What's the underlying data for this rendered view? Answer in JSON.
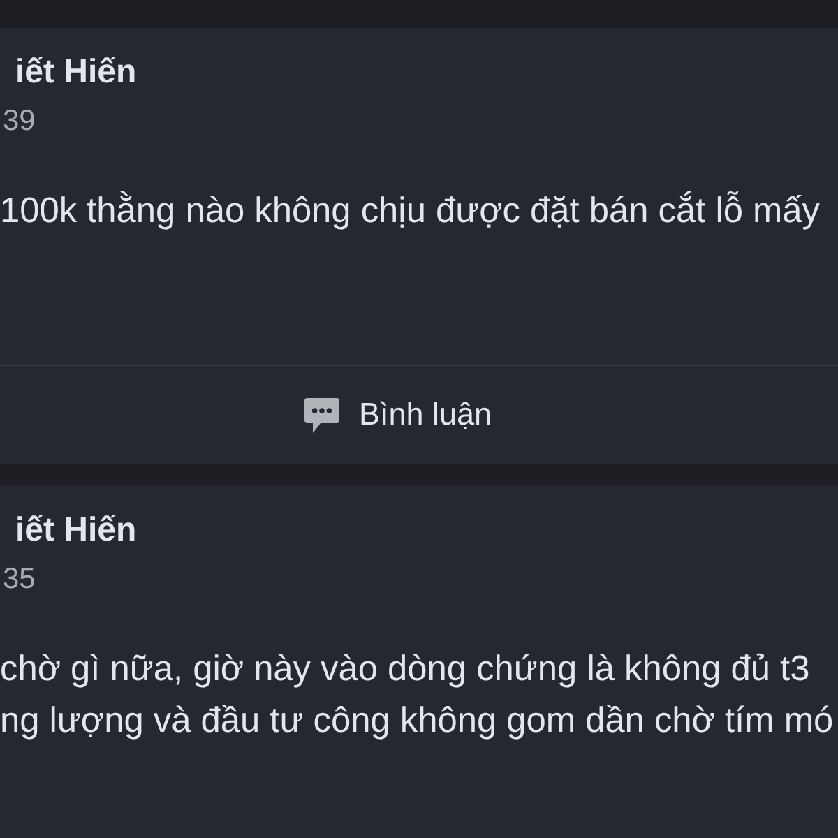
{
  "posts": [
    {
      "author": "iết Hiến",
      "time": "39",
      "body": "100k thằng nào không chịu được đặt bán cắt lỗ mấy",
      "actions": [
        {
          "kind": "comment",
          "label": "Bình luận"
        }
      ]
    },
    {
      "author": "iết Hiến",
      "time": "35",
      "body": "chờ gì nữa, giờ này vào dòng chứng là không đủ t3\nng lượng và đầu tư công không gom dần chờ tím mó"
    }
  ]
}
